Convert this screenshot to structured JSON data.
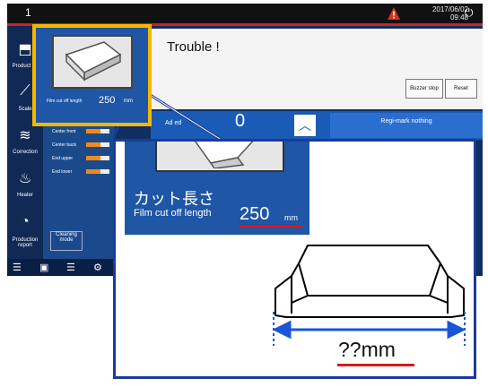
{
  "topbar": {
    "screen_no": "1",
    "date": "2017/06/02",
    "time": "09:48",
    "warning_icon": "warning-icon",
    "power_icon": "power-icon"
  },
  "sidebar": {
    "items": [
      {
        "label": "Product ch",
        "icon": "product-change-icon"
      },
      {
        "label": "Scale",
        "icon": "scale-icon"
      },
      {
        "label": "Correction",
        "icon": "correction-icon"
      },
      {
        "label": "Heater",
        "icon": "heater-icon"
      },
      {
        "label": "Production report",
        "icon": "production-report-icon"
      }
    ]
  },
  "sliders": [
    {
      "label": "Center front",
      "value": "0"
    },
    {
      "label": "Center back",
      "value": "0"
    },
    {
      "label": "End upper",
      "value": "0"
    },
    {
      "label": "End lower",
      "value": "0"
    }
  ],
  "cleaning_mode": "Cleaning mode",
  "dialog": {
    "title": "Trouble !",
    "buzzer_stop": "Buzzer stop",
    "reset": "Reset"
  },
  "status": {
    "speed_label": "Ad    ed",
    "value": "0",
    "regi": "Regi-mark nothing"
  },
  "thumbnail": {
    "label": "Film cut off length",
    "value": "250",
    "unit": "mm"
  },
  "zoom": {
    "label_jp": "カット長さ",
    "label_en": "Film cut off length",
    "value": "250",
    "unit": "mm",
    "unknown": "??mm"
  },
  "colors": {
    "accent_yellow": "#f5b800",
    "screen_blue": "#1f56a6",
    "frame_blue": "#1a3a9c",
    "underline_red": "#e01818",
    "arrow_blue": "#1a55d8"
  }
}
